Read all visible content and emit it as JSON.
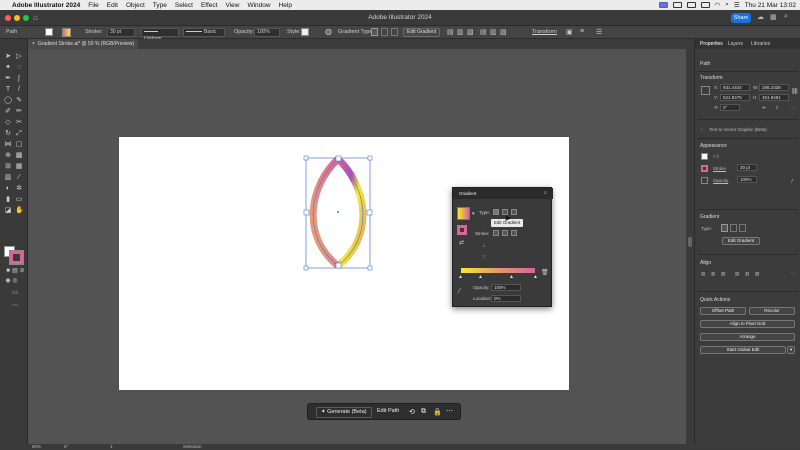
{
  "menubar": {
    "app_name": "Adobe Illustrator 2024",
    "items": [
      "File",
      "Edit",
      "Object",
      "Type",
      "Select",
      "Effect",
      "View",
      "Window",
      "Help"
    ],
    "clock": "Thu 21 Mar  13:02"
  },
  "titlebar": {
    "title": "Adobe Illustrator 2024",
    "share_label": "Share"
  },
  "controlbar": {
    "selection_type": "Path",
    "stroke_label": "Stroke:",
    "stroke_weight": "30 pt",
    "uniform_label": "Uniform",
    "brush_label": "Basic",
    "opacity_label": "Opacity:",
    "opacity_value": "100%",
    "style_label": "Style:",
    "gradient_type_label": "Gradient Type:",
    "edit_gradient_label": "Edit Gradient",
    "transform_label": "Transform"
  },
  "document": {
    "tab_title": "Gradient Stroke.ai* @ 50 % (RGB/Preview)"
  },
  "properties": {
    "tabs": [
      "Properties",
      "Layers",
      "Libraries"
    ],
    "selection": "Path",
    "transform": {
      "title": "Transform",
      "x_label": "X:",
      "x": "931.4434",
      "y_label": "Y:",
      "y": "521.8475",
      "w_label": "W:",
      "w": "286.2338",
      "h_label": "H:",
      "h": "451.9481",
      "angle": "0°"
    },
    "text_to_vector": "Text to Vector Graphic (Beta)",
    "appearance": {
      "title": "Appearance",
      "fill_label": "Fill",
      "stroke_label": "Stroke",
      "stroke_value": "30 pt",
      "opacity_label": "Opacity",
      "opacity_value": "100%"
    },
    "gradient": {
      "title": "Gradient",
      "type_label": "Type:",
      "edit_button": "Edit Gradient"
    },
    "align": {
      "title": "Align"
    },
    "quick_actions": {
      "title": "Quick Actions",
      "offset_path": "Offset Path",
      "recolor": "Recolor",
      "align_pixel_grid": "Align to Pixel Grid",
      "arrange": "Arrange",
      "global_edit": "Start Global Edit"
    }
  },
  "gradient_panel": {
    "title": "Gradient",
    "type_label": "Type:",
    "stroke_label": "Stroke:",
    "tooltip": "Edit Gradient",
    "opacity_label": "Opacity:",
    "opacity_value": "100%",
    "location_label": "Location:",
    "location_value": "0%"
  },
  "taskbar": {
    "generate_label": "Generate (Beta)",
    "edit_path_label": "Edit Path"
  },
  "statusbar": {
    "zoom": "50%",
    "rotation": "0°",
    "artboard": "1",
    "tool": "Selection"
  },
  "colors": {
    "gradient_pink": "#d9649a",
    "gradient_yellow": "#f4ea2e",
    "gradient_tan": "#e1a06a",
    "gradient_purple": "#b24fb8",
    "accent_blue": "#1473e6"
  }
}
